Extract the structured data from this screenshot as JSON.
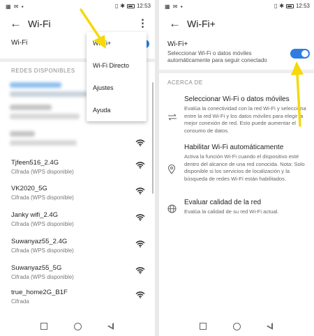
{
  "status": {
    "time": "12:53"
  },
  "left": {
    "title": "Wi-Fi",
    "wifi_row_label": "Wi-Fi",
    "available_header": "REDES DISPONIBLES",
    "networks": [
      {
        "name": "Tjfeen516_2.4G",
        "sub": "Cifrada (WPS disponible)"
      },
      {
        "name": "VK2020_5G",
        "sub": "Cifrada (WPS disponible)"
      },
      {
        "name": "Janky wifi_2.4G",
        "sub": "Cifrada (WPS disponible)"
      },
      {
        "name": "Suwanyaz55_2.4G",
        "sub": "Cifrada (WPS disponible)"
      },
      {
        "name": "Suwanyaz55_5G",
        "sub": "Cifrada (WPS disponible)"
      },
      {
        "name": "true_home2G_B1F",
        "sub": "Cifrada"
      }
    ],
    "menu": [
      "Wi-Fi+",
      "Wi-Fi Directo",
      "Ajustes",
      "Ayuda"
    ]
  },
  "right": {
    "title": "Wi-Fi+",
    "wifi_plus": {
      "title": "Wi-Fi+",
      "desc": "Seleccionar Wi-Fi o datos móviles automáticamente para seguir conectado",
      "enabled": true
    },
    "about_header": "ACERCA DE",
    "items": [
      {
        "icon": "swap-arrows-icon",
        "title": "Seleccionar Wi-Fi o datos móviles",
        "desc": "Evalúa la conectividad con la red Wi-Fi y selecciona entre la red Wi-Fi y los datos móviles para elegir la mejor conexión de red. Esto puede aumentar el consumo de datos."
      },
      {
        "icon": "location-pin-icon",
        "title": "Habilitar Wi-Fi automáticamente",
        "desc": "Activa la función Wi-Fi cuando el dispositivo esté dentro del alcance de una red conocida. Nota: Solo disponible si los servicios de localización y la búsqueda de redes Wi-Fi están habilitados."
      },
      {
        "icon": "globe-icon",
        "title": "Evaluar calidad de la red",
        "desc": "Evalúa la calidad de su red Wi-Fi actual."
      }
    ]
  },
  "colors": {
    "accent": "#2f7de1",
    "arrow": "#f5d90a"
  }
}
